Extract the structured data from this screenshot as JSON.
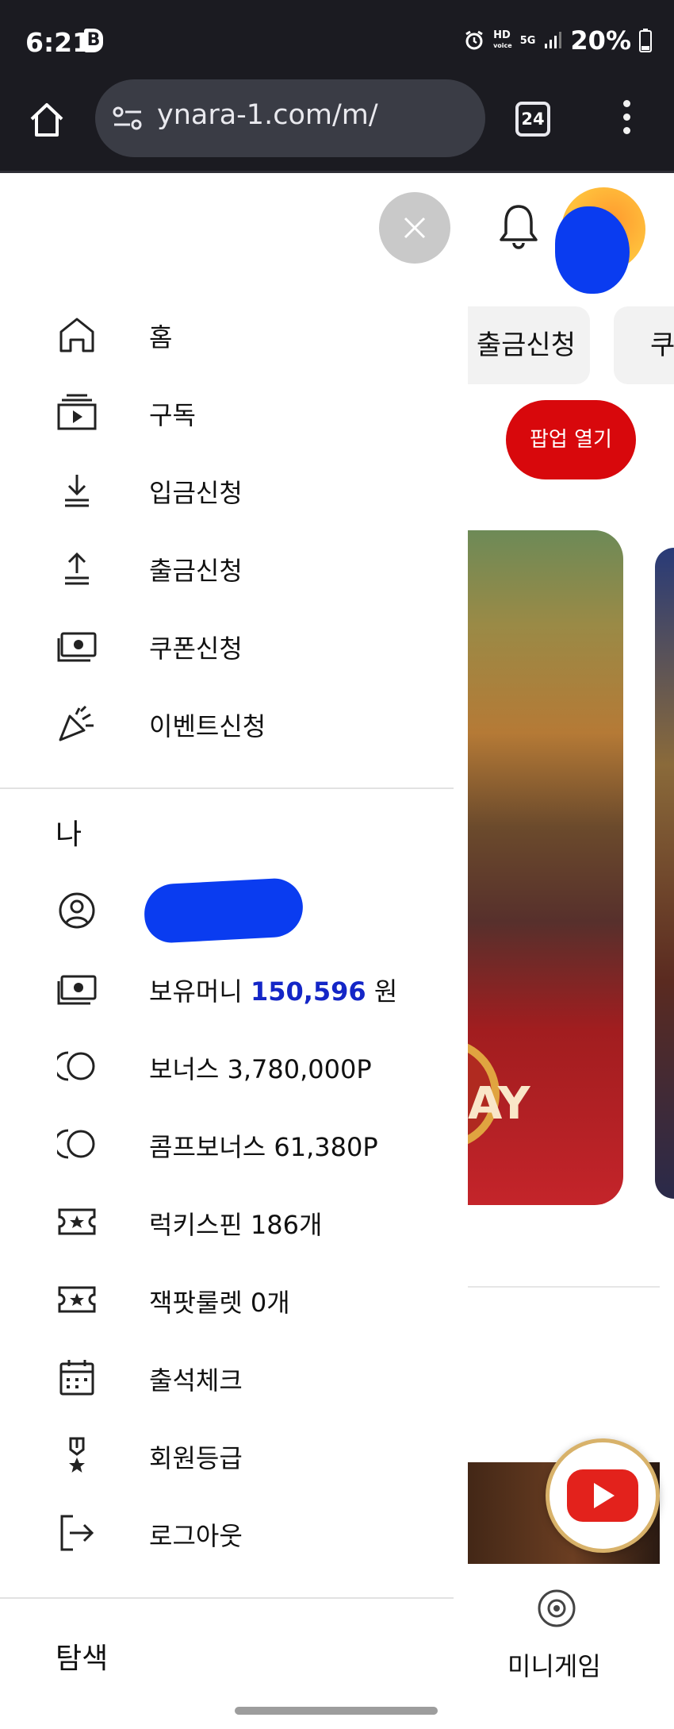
{
  "status_bar": {
    "time": "6:21",
    "b_badge": "B",
    "hd": "HD",
    "voice": "voice",
    "net": "5G",
    "battery": "20%"
  },
  "browser": {
    "url": "ynara-1.com/m/",
    "tab_count": "24"
  },
  "drawer": {
    "menu": [
      {
        "label": "홈",
        "icon": "home-icon"
      },
      {
        "label": "구독",
        "icon": "subscriptions-icon"
      },
      {
        "label": "입금신청",
        "icon": "download-icon"
      },
      {
        "label": "출금신청",
        "icon": "upload-icon"
      },
      {
        "label": "쿠폰신청",
        "icon": "cash-icon"
      },
      {
        "label": "이벤트신청",
        "icon": "party-popper-icon"
      }
    ],
    "section_me": "나",
    "me": {
      "money_prefix": "보유머니 ",
      "money_value": "150,596",
      "money_suffix": " 원",
      "bonus": "보너스 3,780,000P",
      "comp_bonus": "콤프보너스 61,380P",
      "lucky_spin": "럭키스핀 186개",
      "jackpot_roulette": "잭팟룰렛 0개",
      "attendance": "출석체크",
      "member_grade": "회원등급",
      "logout": "로그아웃"
    },
    "section_explore": "탐색"
  },
  "page": {
    "chip_withdraw": "출금신청",
    "chip_next": "쿠",
    "popup_button": "팝업 열기",
    "banner_text": "AY",
    "mini_game": "미니게임"
  },
  "colors": {
    "chrome_bg": "#1b1b21",
    "money": "#1426c7",
    "popup_red": "#d8080c"
  }
}
